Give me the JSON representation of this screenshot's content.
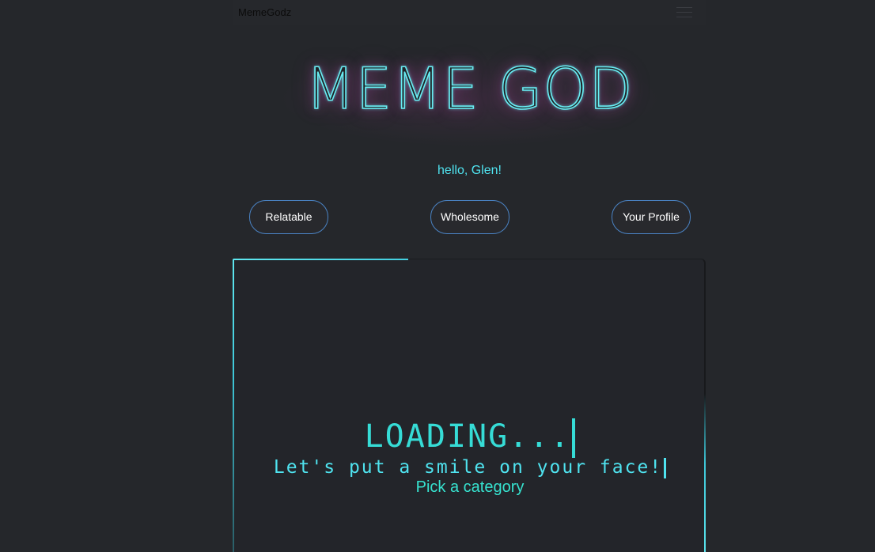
{
  "navbar": {
    "brand": "MemeGodz",
    "menu_icon": "hamburger-menu-icon"
  },
  "hero": {
    "title": "MEME GOD"
  },
  "greeting": "hello, Glen!",
  "categories": [
    {
      "label": "Relatable"
    },
    {
      "label": "Wholesome"
    },
    {
      "label": "Your Profile"
    }
  ],
  "loader": {
    "heading": "LOADING...",
    "tagline": "Let's put a smile on your face!",
    "prompt": "Pick a category"
  },
  "colors": {
    "background": "#25272b",
    "accent_cyan": "#4fe3ef",
    "button_border": "#4a83c4",
    "neon_glow": "#c850be"
  }
}
